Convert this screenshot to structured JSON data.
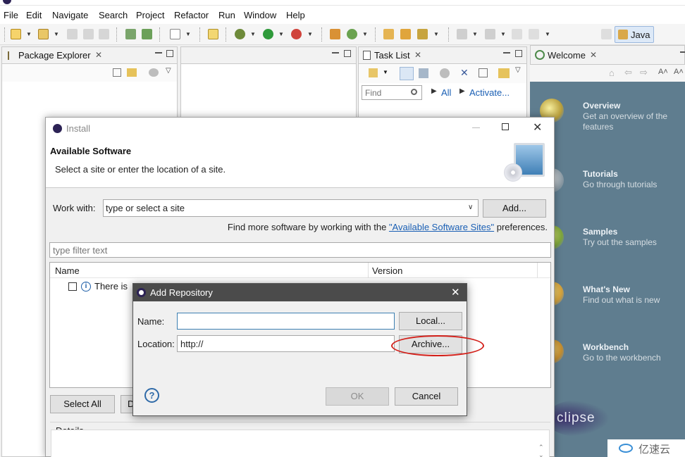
{
  "menu": [
    "File",
    "Edit",
    "Navigate",
    "Search",
    "Project",
    "Refactor",
    "Run",
    "Window",
    "Help"
  ],
  "toolbar": {
    "perspective_label": "Java"
  },
  "views": {
    "package_explorer": "Package Explorer",
    "task_list": "Task List",
    "task_find_placeholder": "Find",
    "task_all": "All",
    "task_activate": "Activate...",
    "welcome": "Welcome"
  },
  "welcome_items": [
    {
      "title": "Overview",
      "desc": "Get an overview of the features"
    },
    {
      "title": "Tutorials",
      "desc": "Go through tutorials"
    },
    {
      "title": "Samples",
      "desc": "Try out the samples"
    },
    {
      "title": "What's New",
      "desc": "Find out what is new"
    },
    {
      "title": "Workbench",
      "desc": "Go to the workbench"
    }
  ],
  "welcome_brand": "clipse",
  "install": {
    "title": "Install",
    "heading": "Available Software",
    "subheading": "Select a site or enter the location of a site.",
    "work_with_label": "Work with:",
    "work_with_value": "type or select a site",
    "add_button": "Add...",
    "find_more_prefix": "Find more software by working with the ",
    "find_more_link": "\"Available Software Sites\"",
    "find_more_suffix": " preferences.",
    "filter_placeholder": "type filter text",
    "col_name": "Name",
    "col_version": "Version",
    "row_text": "There is",
    "select_all": "Select All",
    "deselect_partial": "D",
    "details": "Details"
  },
  "add_repo": {
    "title": "Add Repository",
    "name_label": "Name:",
    "name_value": "",
    "location_label": "Location:",
    "location_value": "http://",
    "local_button": "Local...",
    "archive_button": "Archive...",
    "ok_button": "OK",
    "cancel_button": "Cancel",
    "help_icon": "?"
  },
  "watermark": "亿速云",
  "colors": {
    "callout": "#d3201a",
    "welcome_bg": "#5f7d8f",
    "link": "#1a5fb4"
  }
}
